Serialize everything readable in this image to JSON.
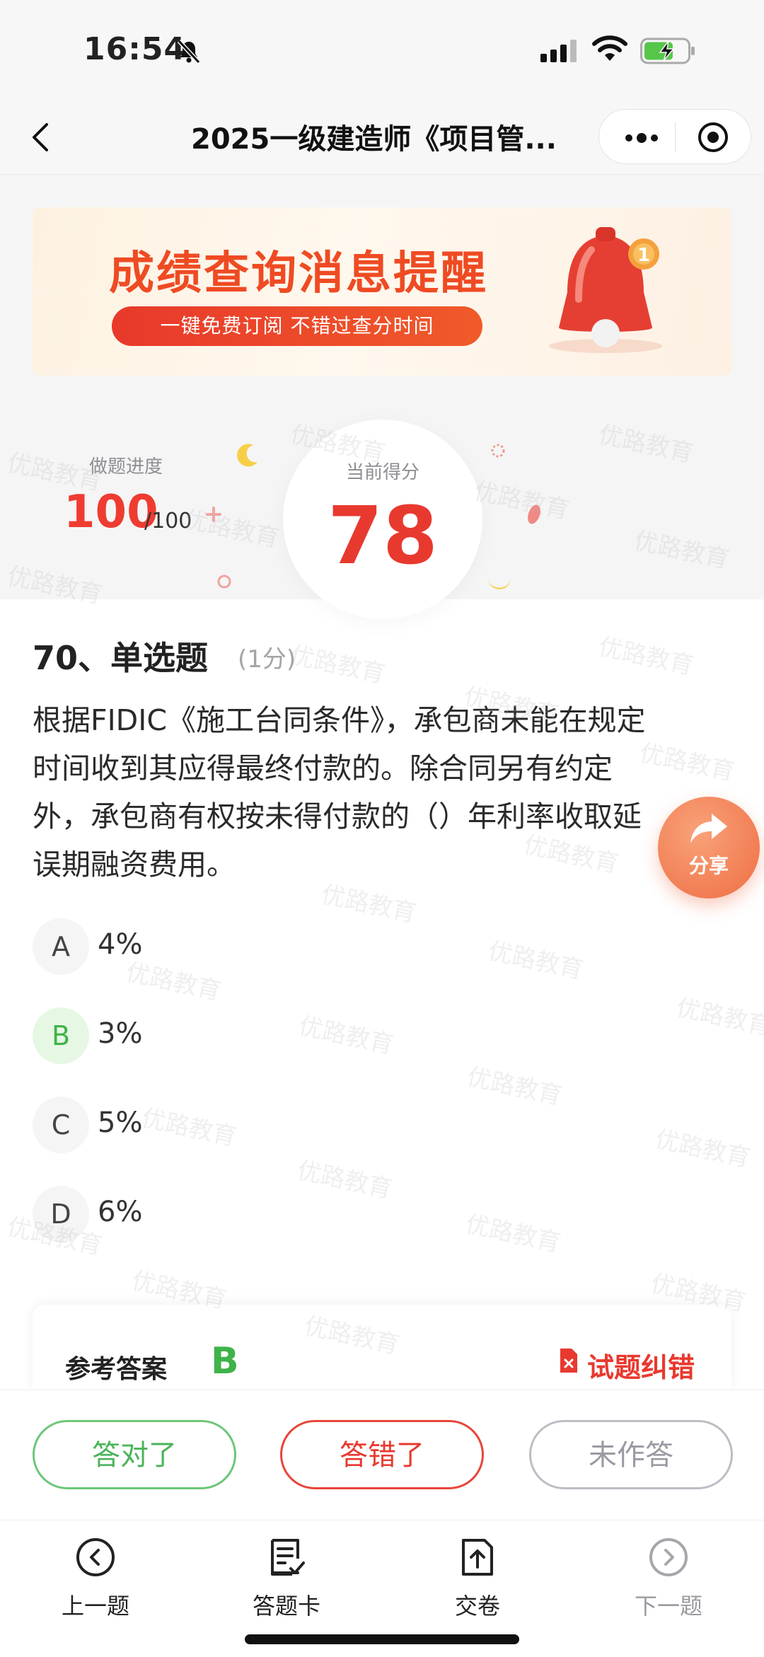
{
  "status_bar": {
    "time": "16:54"
  },
  "nav": {
    "title": "2025一级建造师《项目管..."
  },
  "banner": {
    "headline": "成绩查询消息提醒",
    "pill_text": "一键免费订阅  不错过查分时间",
    "badge_number": "1"
  },
  "stats": {
    "progress_label": "做题进度",
    "progress_value": "100",
    "progress_total": "/100",
    "score_label": "当前得分",
    "score_value": "78"
  },
  "question": {
    "heading": "70、单选题",
    "points": "(1分)",
    "stem": "根据FIDIC《施工台同条件》，承包商未能在规定时间收到其应得最终付款的。除合同另有约定外，承包商有权按未得付款的（）年利率收取延误期融资费用。",
    "options": [
      {
        "letter": "A",
        "text": "4%"
      },
      {
        "letter": "B",
        "text": "3%"
      },
      {
        "letter": "C",
        "text": "5%"
      },
      {
        "letter": "D",
        "text": "6%"
      }
    ],
    "correct_letter": "B"
  },
  "share": {
    "label": "分享"
  },
  "answer_card": {
    "ref_label": "参考答案",
    "ref_value": "B",
    "report_label": "试题纠错"
  },
  "actions": {
    "right": "答对了",
    "wrong": "答错了",
    "none": "未作答"
  },
  "tabs": [
    {
      "label": "上一题",
      "icon": "prev-circle-icon"
    },
    {
      "label": "答题卡",
      "icon": "answer-card-icon"
    },
    {
      "label": "交卷",
      "icon": "submit-icon"
    },
    {
      "label": "下一题",
      "icon": "next-circle-icon"
    }
  ],
  "watermark": "优路教育",
  "colors": {
    "brand_red": "#e8392f",
    "correct_green": "#3fb34a",
    "share_orange": "#ee6e43",
    "muted_gray": "#9a9aa4"
  }
}
